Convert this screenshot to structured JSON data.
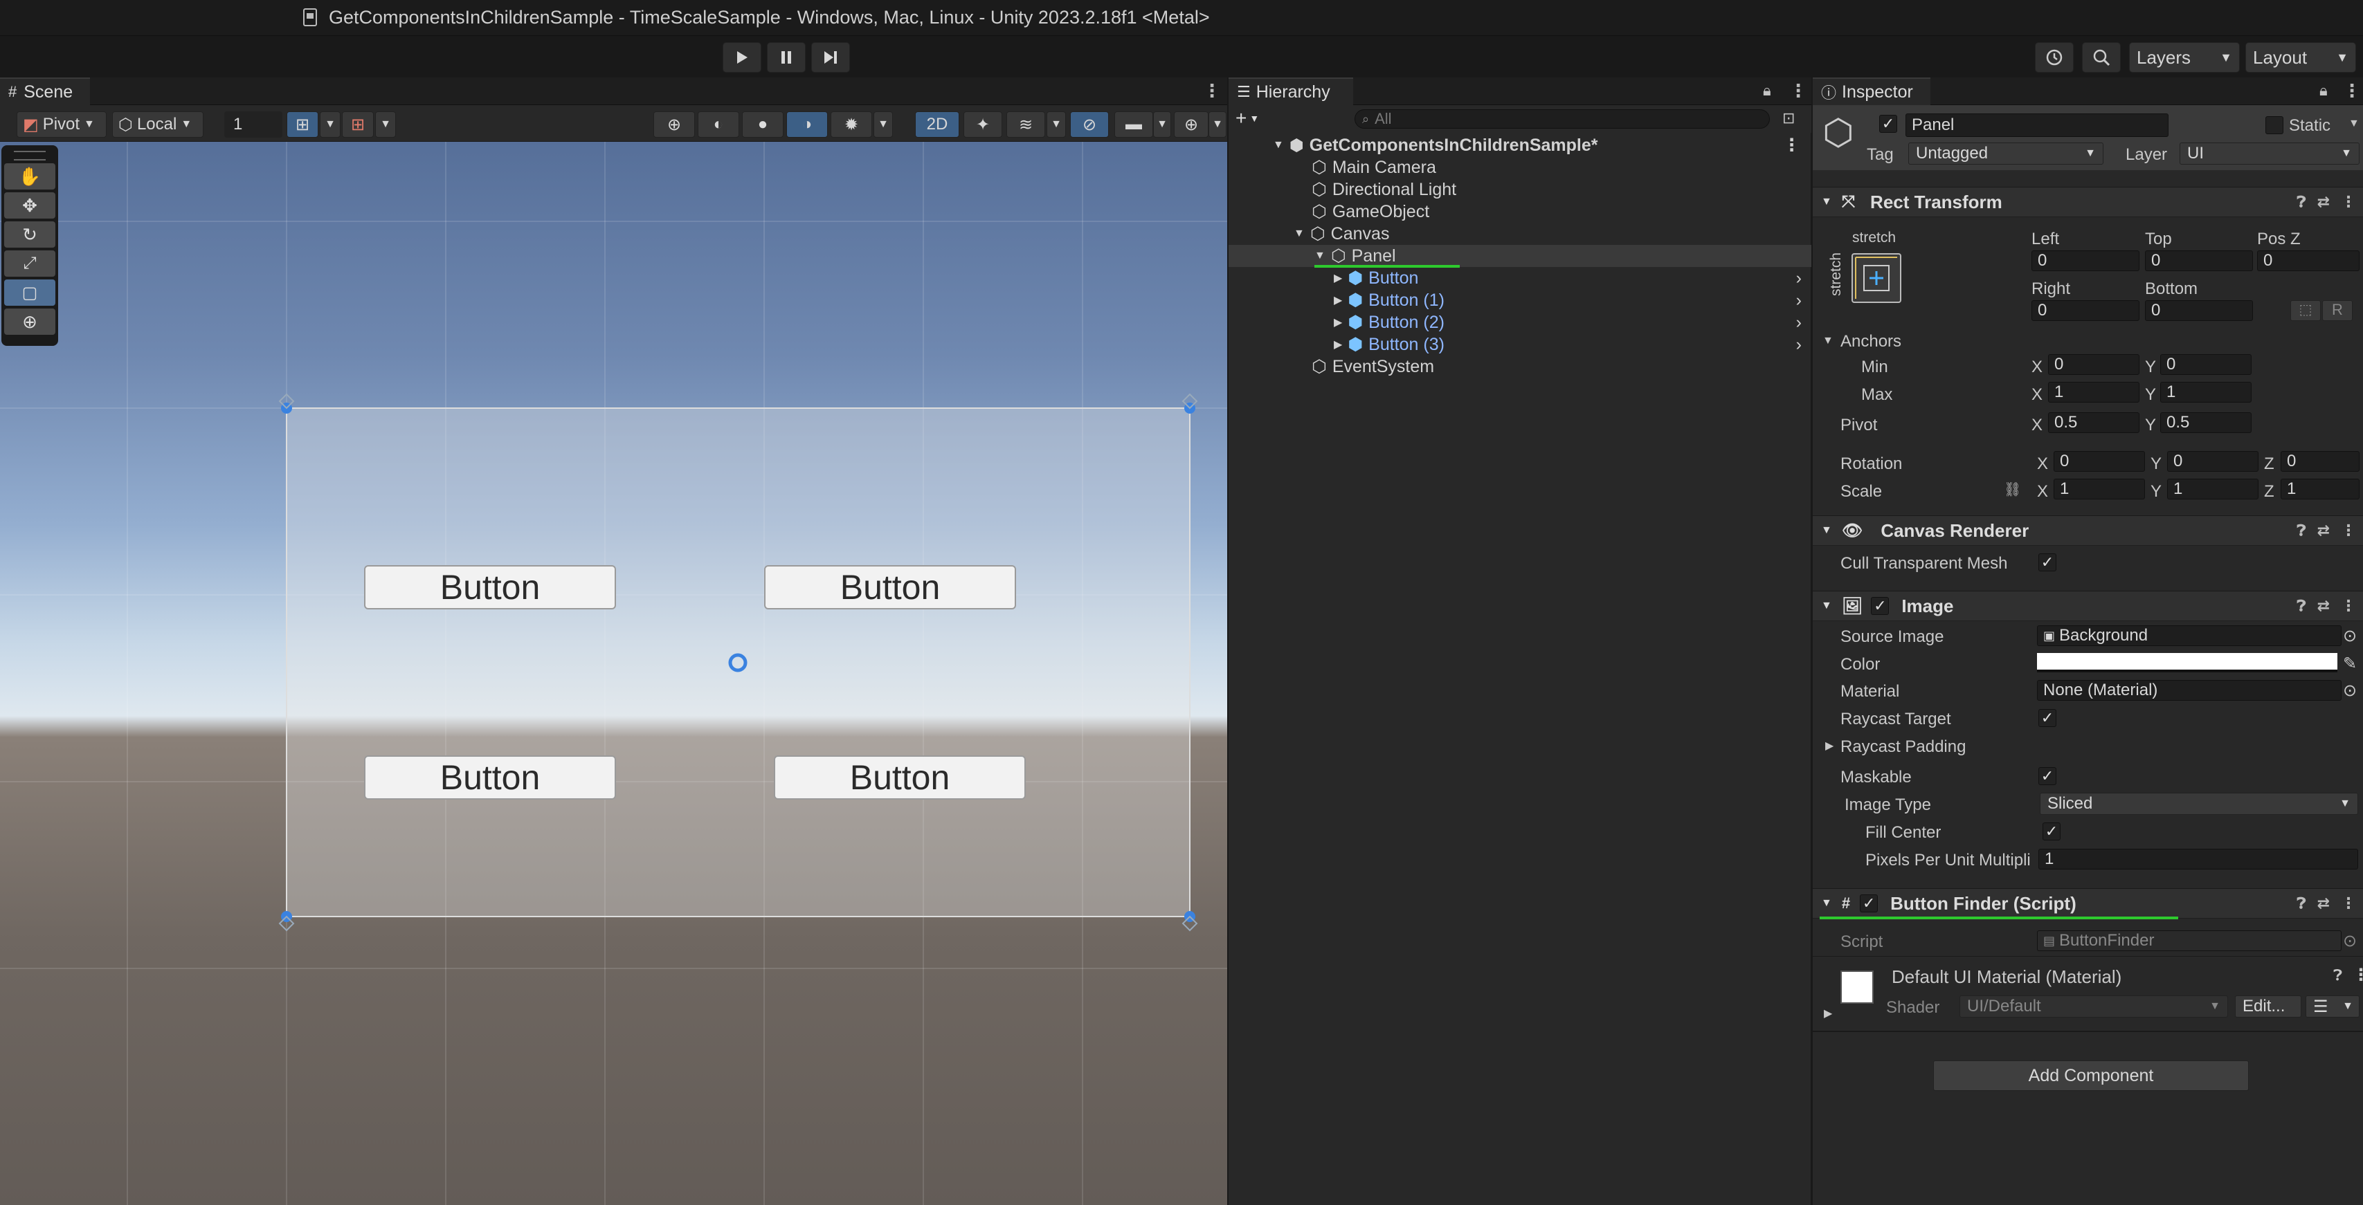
{
  "window": {
    "title": "GetComponentsInChildrenSample - TimeScaleSample - Windows, Mac, Linux - Unity 2023.2.18f1 <Metal>"
  },
  "toolbar": {
    "layers_label": "Layers",
    "layout_label": "Layout"
  },
  "scene": {
    "tab_label": "Scene",
    "pivot_label": "Pivot",
    "local_label": "Local",
    "grid_snap_value": "1",
    "mode_2d_label": "2D",
    "buttons": [
      {
        "label": "Button"
      },
      {
        "label": "Button"
      },
      {
        "label": "Button"
      },
      {
        "label": "Button"
      }
    ]
  },
  "hierarchy": {
    "tab_label": "Hierarchy",
    "search_placeholder": "All",
    "items": [
      {
        "label": "GetComponentsInChildrenSample*"
      },
      {
        "label": "Main Camera"
      },
      {
        "label": "Directional Light"
      },
      {
        "label": "GameObject"
      },
      {
        "label": "Canvas"
      },
      {
        "label": "Panel"
      },
      {
        "label": "Button"
      },
      {
        "label": "Button (1)"
      },
      {
        "label": "Button (2)"
      },
      {
        "label": "Button (3)"
      },
      {
        "label": "EventSystem"
      }
    ]
  },
  "inspector": {
    "tab_label": "Inspector",
    "object_name": "Panel",
    "static_label": "Static",
    "tag_label": "Tag",
    "tag_value": "Untagged",
    "layer_label": "Layer",
    "layer_value": "UI",
    "rect_transform": {
      "title": "Rect Transform",
      "anchor_preset_top": "stretch",
      "anchor_preset_side": "stretch",
      "left_label": "Left",
      "left_value": "0",
      "top_label": "Top",
      "top_value": "0",
      "posz_label": "Pos Z",
      "posz_value": "0",
      "right_label": "Right",
      "right_value": "0",
      "bottom_label": "Bottom",
      "bottom_value": "0",
      "r_button": "R",
      "anchors_label": "Anchors",
      "min_label": "Min",
      "min_x": "0",
      "min_y": "0",
      "max_label": "Max",
      "max_x": "1",
      "max_y": "1",
      "pivot_label": "Pivot",
      "pivot_x": "0.5",
      "pivot_y": "0.5",
      "rotation_label": "Rotation",
      "rot_x": "0",
      "rot_y": "0",
      "rot_z": "0",
      "scale_label": "Scale",
      "scale_x": "1",
      "scale_y": "1",
      "scale_z": "1",
      "x": "X",
      "y": "Y",
      "z": "Z"
    },
    "canvas_renderer": {
      "title": "Canvas Renderer",
      "cull_label": "Cull Transparent Mesh"
    },
    "image": {
      "title": "Image",
      "source_label": "Source Image",
      "source_value": "Background",
      "color_label": "Color",
      "material_label": "Material",
      "material_value": "None (Material)",
      "raycast_label": "Raycast Target",
      "raycast_padding_label": "Raycast Padding",
      "maskable_label": "Maskable",
      "image_type_label": "Image Type",
      "image_type_value": "Sliced",
      "fill_center_label": "Fill Center",
      "ppu_label": "Pixels Per Unit Multipli",
      "ppu_value": "1"
    },
    "button_finder": {
      "title": "Button Finder (Script)",
      "script_label": "Script",
      "script_value": "ButtonFinder"
    },
    "material": {
      "title": "Default UI Material (Material)",
      "shader_label": "Shader",
      "shader_value": "UI/Default",
      "edit_label": "Edit..."
    },
    "add_component_label": "Add Component"
  },
  "colors": {
    "accent_blue": "#3c5f86",
    "highlight_green": "#2ec92e",
    "child_blue": "#8fb7ff"
  }
}
